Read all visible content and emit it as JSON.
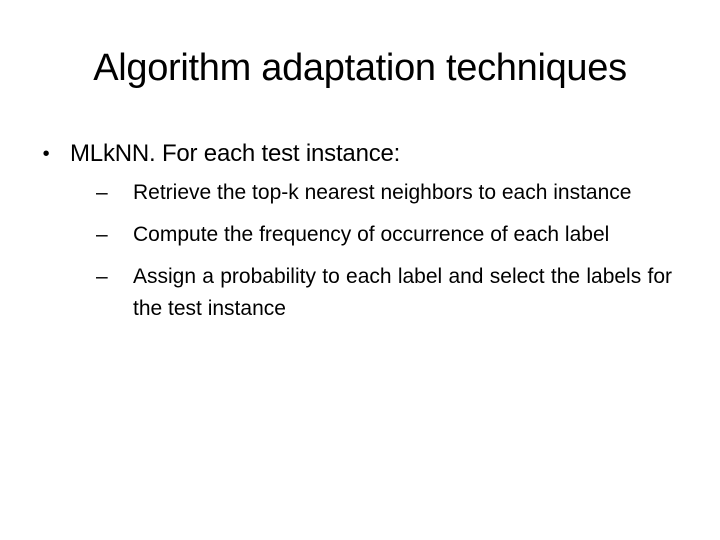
{
  "slide": {
    "title": "Algorithm adaptation techniques",
    "bullets": [
      {
        "marker": "•",
        "text": "MLkNN. For each test instance:",
        "sub_bullets": [
          {
            "marker": "–",
            "text": "Retrieve the top-k nearest neighbors to each instance"
          },
          {
            "marker": "–",
            "text": "Compute the frequency of occurrence of each label"
          },
          {
            "marker": "–",
            "text": "Assign a probability to each label and select the labels for the test instance"
          }
        ]
      }
    ]
  },
  "colors": {
    "background": "#ffffff",
    "text": "#000000"
  }
}
